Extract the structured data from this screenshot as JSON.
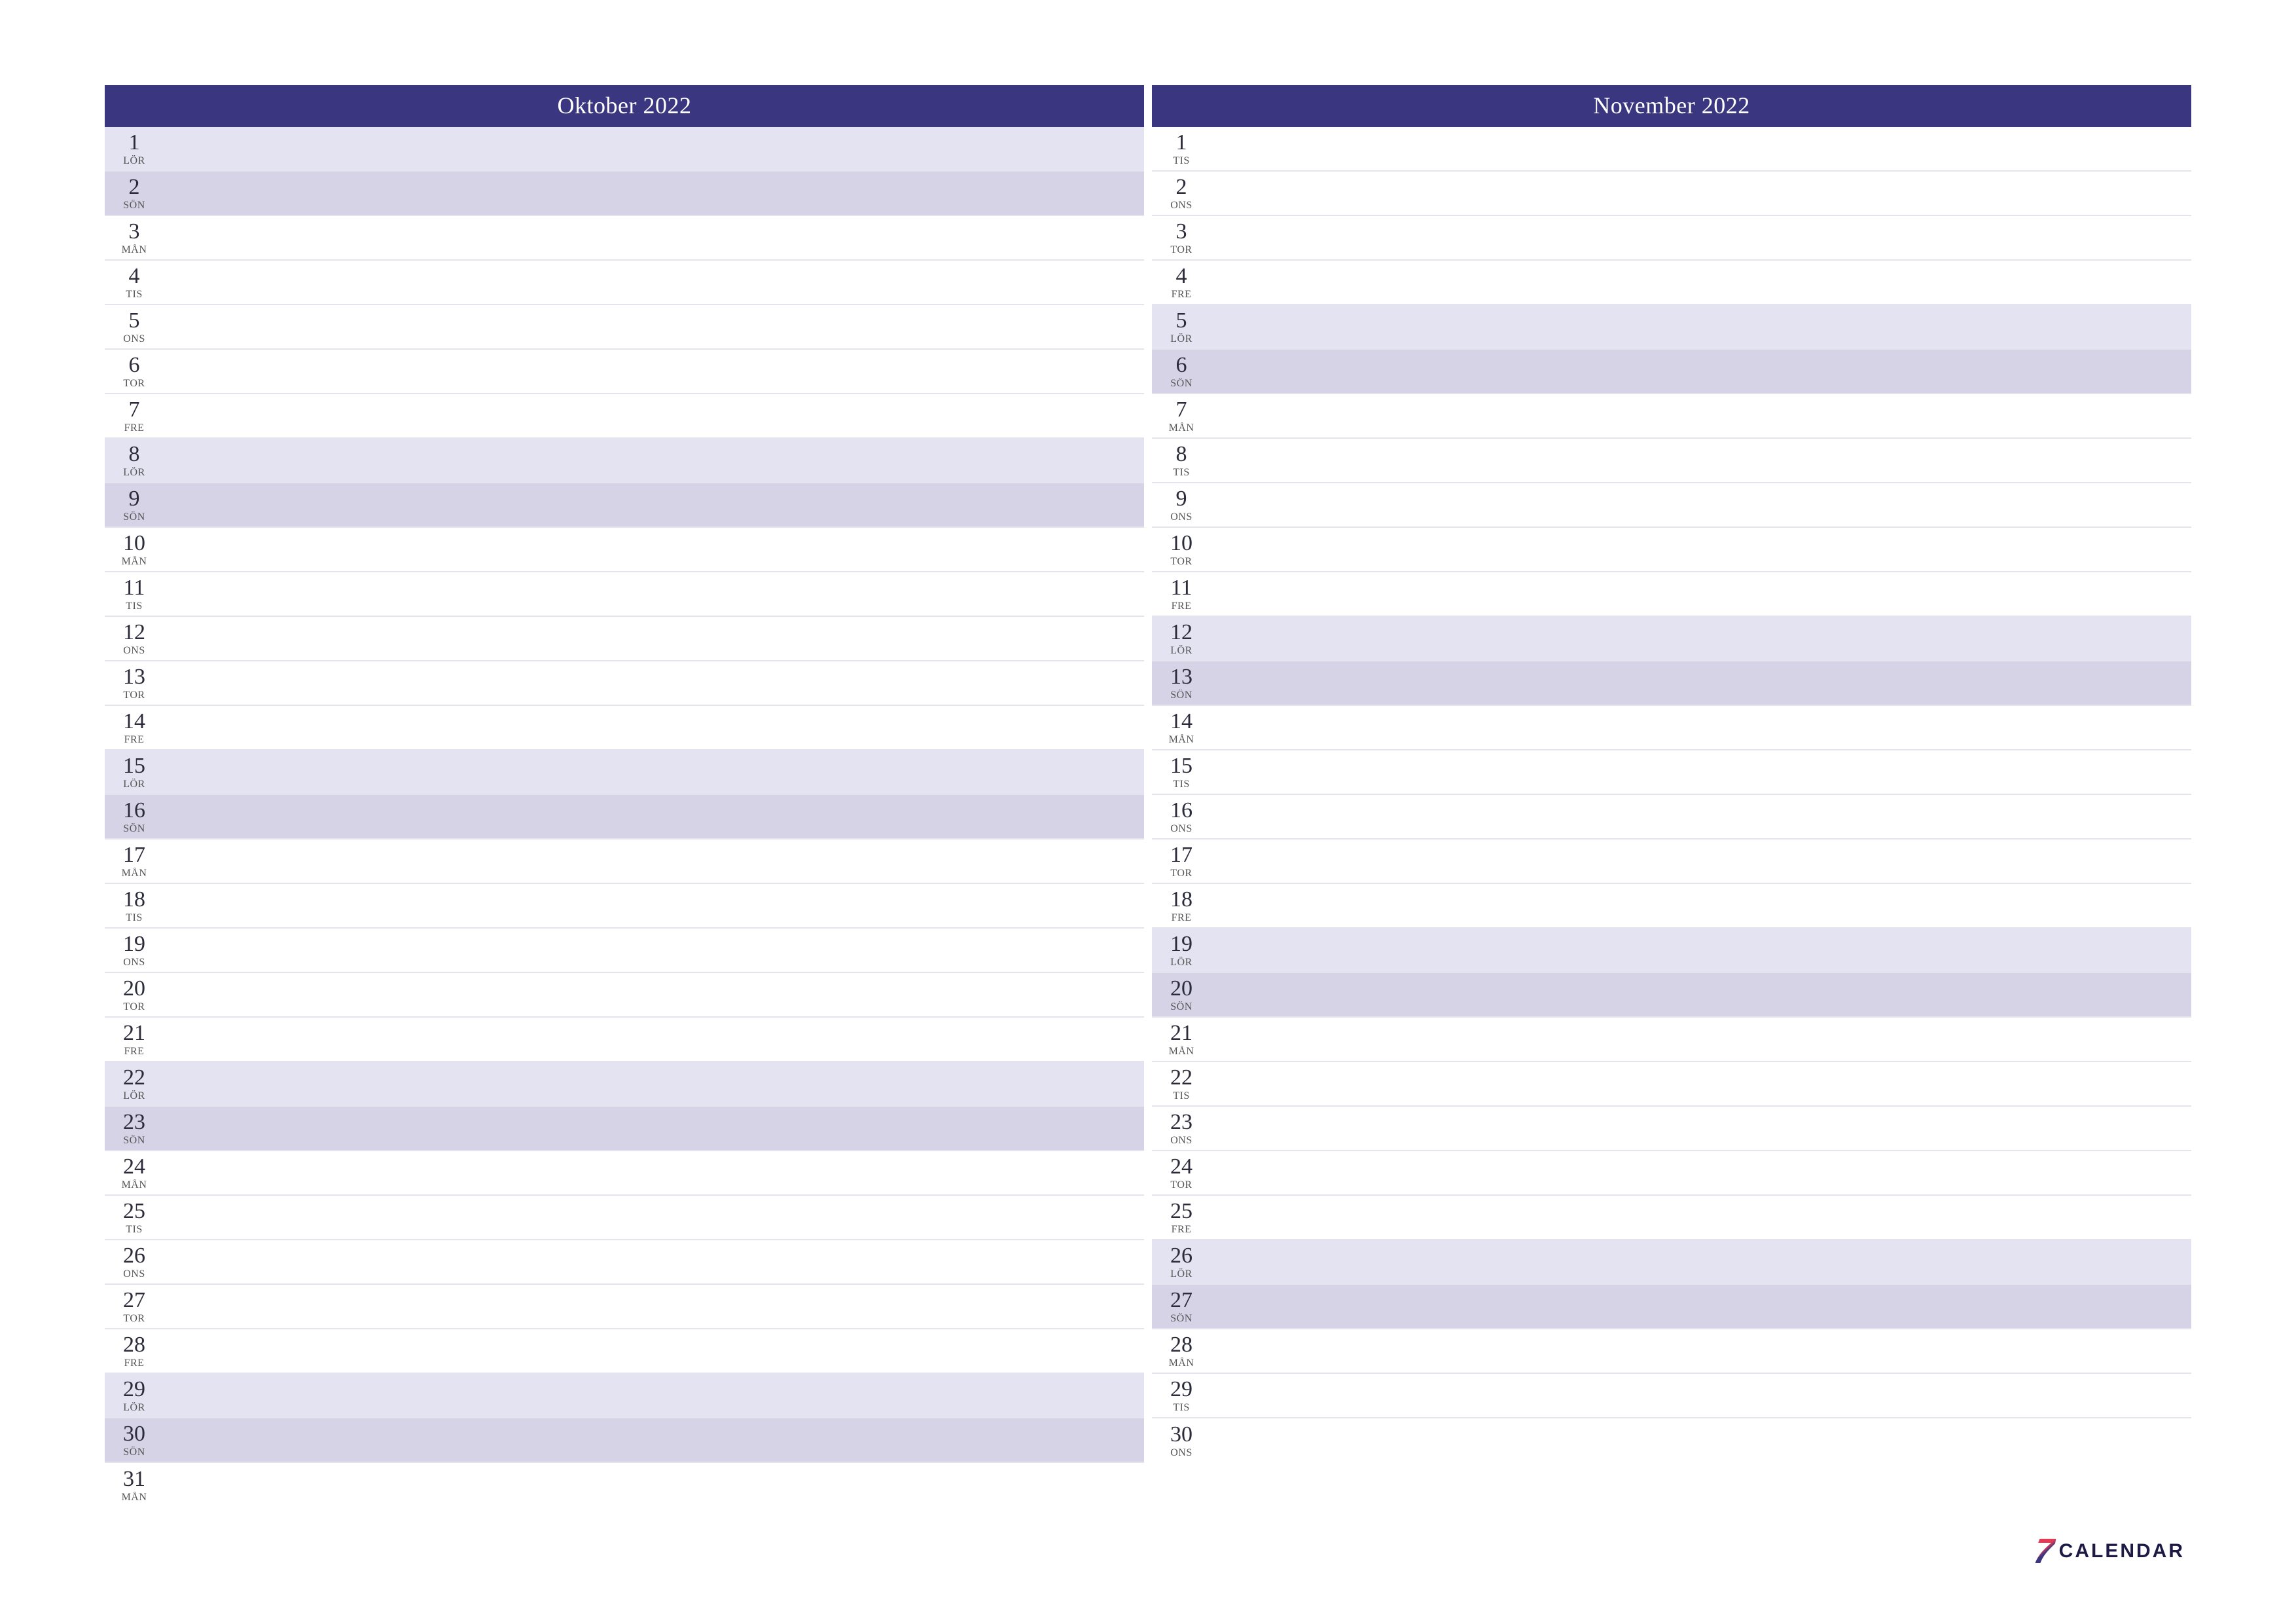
{
  "logo": {
    "seven": "7",
    "word": "CALENDAR"
  },
  "day_types": {
    "MÅN": "bg-weekday",
    "TIS": "bg-weekday",
    "ONS": "bg-weekday",
    "TOR": "bg-weekday",
    "FRE": "bg-weekday",
    "LÖR": "bg-sat",
    "SÖN": "bg-sun"
  },
  "months": [
    {
      "title": "Oktober 2022",
      "days": [
        {
          "n": "1",
          "abbr": "LÖR"
        },
        {
          "n": "2",
          "abbr": "SÖN"
        },
        {
          "n": "3",
          "abbr": "MÅN"
        },
        {
          "n": "4",
          "abbr": "TIS"
        },
        {
          "n": "5",
          "abbr": "ONS"
        },
        {
          "n": "6",
          "abbr": "TOR"
        },
        {
          "n": "7",
          "abbr": "FRE"
        },
        {
          "n": "8",
          "abbr": "LÖR"
        },
        {
          "n": "9",
          "abbr": "SÖN"
        },
        {
          "n": "10",
          "abbr": "MÅN"
        },
        {
          "n": "11",
          "abbr": "TIS"
        },
        {
          "n": "12",
          "abbr": "ONS"
        },
        {
          "n": "13",
          "abbr": "TOR"
        },
        {
          "n": "14",
          "abbr": "FRE"
        },
        {
          "n": "15",
          "abbr": "LÖR"
        },
        {
          "n": "16",
          "abbr": "SÖN"
        },
        {
          "n": "17",
          "abbr": "MÅN"
        },
        {
          "n": "18",
          "abbr": "TIS"
        },
        {
          "n": "19",
          "abbr": "ONS"
        },
        {
          "n": "20",
          "abbr": "TOR"
        },
        {
          "n": "21",
          "abbr": "FRE"
        },
        {
          "n": "22",
          "abbr": "LÖR"
        },
        {
          "n": "23",
          "abbr": "SÖN"
        },
        {
          "n": "24",
          "abbr": "MÅN"
        },
        {
          "n": "25",
          "abbr": "TIS"
        },
        {
          "n": "26",
          "abbr": "ONS"
        },
        {
          "n": "27",
          "abbr": "TOR"
        },
        {
          "n": "28",
          "abbr": "FRE"
        },
        {
          "n": "29",
          "abbr": "LÖR"
        },
        {
          "n": "30",
          "abbr": "SÖN"
        },
        {
          "n": "31",
          "abbr": "MÅN"
        }
      ]
    },
    {
      "title": "November 2022",
      "days": [
        {
          "n": "1",
          "abbr": "TIS"
        },
        {
          "n": "2",
          "abbr": "ONS"
        },
        {
          "n": "3",
          "abbr": "TOR"
        },
        {
          "n": "4",
          "abbr": "FRE"
        },
        {
          "n": "5",
          "abbr": "LÖR"
        },
        {
          "n": "6",
          "abbr": "SÖN"
        },
        {
          "n": "7",
          "abbr": "MÅN"
        },
        {
          "n": "8",
          "abbr": "TIS"
        },
        {
          "n": "9",
          "abbr": "ONS"
        },
        {
          "n": "10",
          "abbr": "TOR"
        },
        {
          "n": "11",
          "abbr": "FRE"
        },
        {
          "n": "12",
          "abbr": "LÖR"
        },
        {
          "n": "13",
          "abbr": "SÖN"
        },
        {
          "n": "14",
          "abbr": "MÅN"
        },
        {
          "n": "15",
          "abbr": "TIS"
        },
        {
          "n": "16",
          "abbr": "ONS"
        },
        {
          "n": "17",
          "abbr": "TOR"
        },
        {
          "n": "18",
          "abbr": "FRE"
        },
        {
          "n": "19",
          "abbr": "LÖR"
        },
        {
          "n": "20",
          "abbr": "SÖN"
        },
        {
          "n": "21",
          "abbr": "MÅN"
        },
        {
          "n": "22",
          "abbr": "TIS"
        },
        {
          "n": "23",
          "abbr": "ONS"
        },
        {
          "n": "24",
          "abbr": "TOR"
        },
        {
          "n": "25",
          "abbr": "FRE"
        },
        {
          "n": "26",
          "abbr": "LÖR"
        },
        {
          "n": "27",
          "abbr": "SÖN"
        },
        {
          "n": "28",
          "abbr": "MÅN"
        },
        {
          "n": "29",
          "abbr": "TIS"
        },
        {
          "n": "30",
          "abbr": "ONS"
        }
      ]
    }
  ]
}
